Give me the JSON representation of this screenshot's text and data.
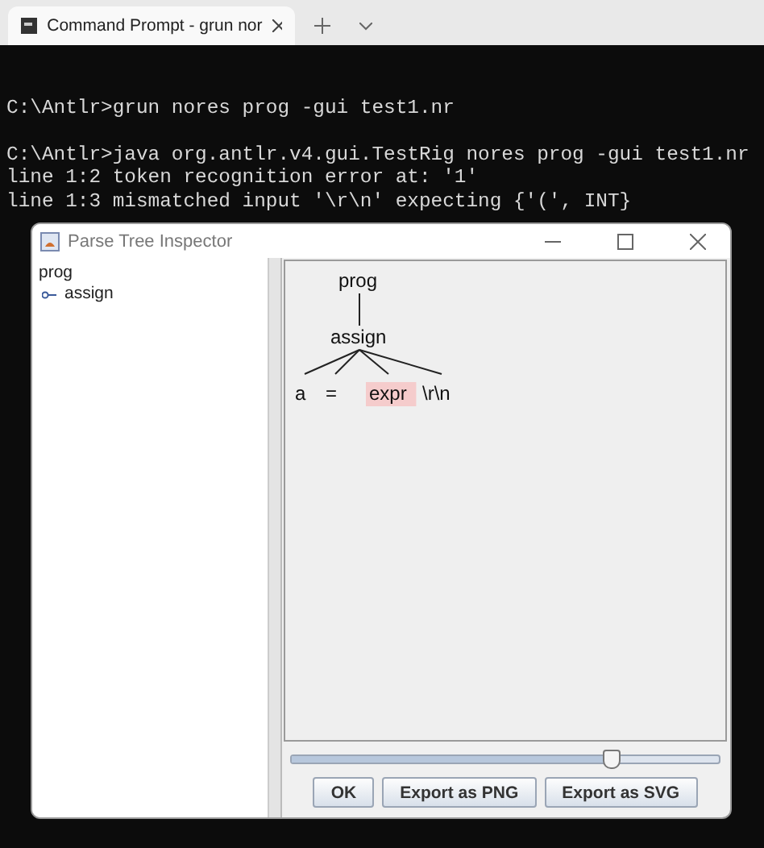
{
  "terminal": {
    "tab": {
      "title": "Command Prompt - grun  nor",
      "selected": true
    },
    "lines": [
      {
        "kind": "blank"
      },
      {
        "kind": "text",
        "text": "C:\\Antlr>grun nores prog -gui test1.nr"
      },
      {
        "kind": "blank"
      },
      {
        "kind": "text",
        "text": "C:\\Antlr>java org.antlr.v4.gui.TestRig nores prog -gui test1.nr"
      },
      {
        "kind": "text",
        "text": "line 1:2 token recognition error at: '1'"
      },
      {
        "kind": "text",
        "text": "line 1:3 mismatched input '\\r\\n' expecting {'(', INT}"
      }
    ]
  },
  "dialog": {
    "title": "Parse Tree Inspector",
    "outline": [
      {
        "label": "prog",
        "children": [
          {
            "label": "assign"
          }
        ]
      }
    ],
    "tree": {
      "label": "prog",
      "error": false,
      "children": [
        {
          "label": "assign",
          "error": false,
          "children": [
            {
              "label": "a",
              "error": false
            },
            {
              "label": "=",
              "error": false
            },
            {
              "label": "expr",
              "error": true
            },
            {
              "label": "\\r\\n",
              "error": false
            }
          ]
        }
      ]
    },
    "zoom": {
      "level": 0.75
    },
    "buttons": [
      "OK",
      "Export as PNG",
      "Export as SVG"
    ]
  }
}
